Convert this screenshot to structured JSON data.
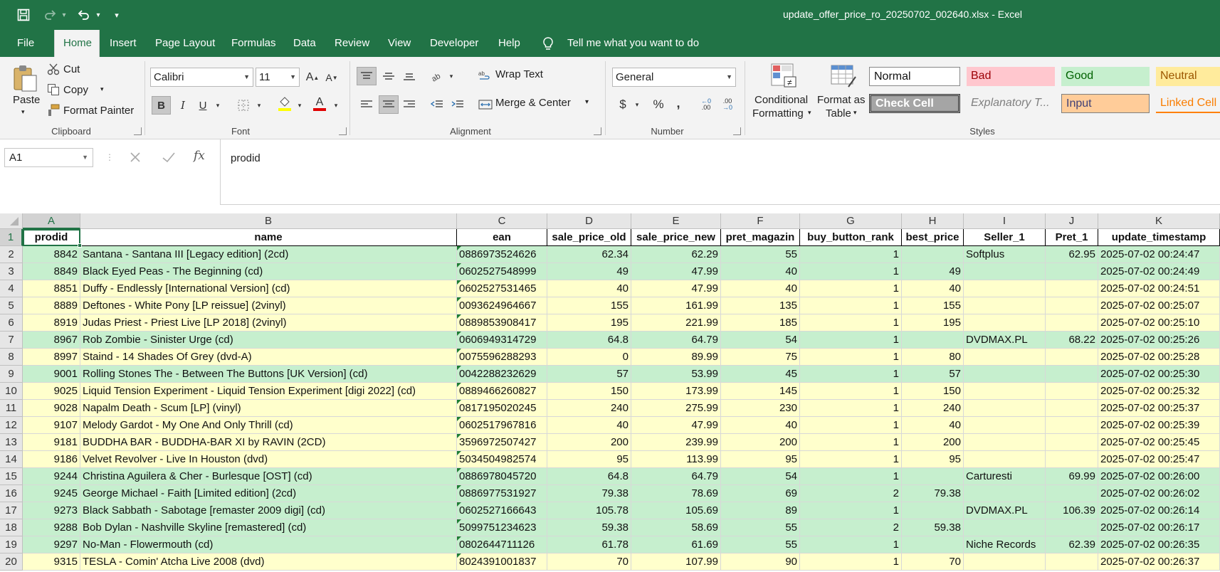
{
  "title_bar": {
    "document_title": "update_offer_price_ro_20250702_002640.xlsx  -  Excel",
    "save_icon": "save-icon",
    "redo_icon": "redo-icon",
    "undo_icon": "undo-icon",
    "customize_icon": "customize-qat-icon"
  },
  "tabs": [
    "File",
    "Home",
    "Insert",
    "Page Layout",
    "Formulas",
    "Data",
    "Review",
    "View",
    "Developer",
    "Help"
  ],
  "active_tab": "Home",
  "tell_me": "Tell me what you want to do",
  "ribbon": {
    "clipboard": {
      "paste": "Paste",
      "cut": "Cut",
      "copy": "Copy",
      "format_painter": "Format Painter",
      "label": "Clipboard"
    },
    "font": {
      "family": "Calibri",
      "size": "11",
      "bold": "B",
      "italic": "I",
      "underline": "U",
      "grow": "A",
      "shrink": "A",
      "font_color": "A",
      "label": "Font"
    },
    "alignment": {
      "wrap_text": "Wrap Text",
      "merge_center": "Merge & Center",
      "label": "Alignment"
    },
    "number": {
      "format": "General",
      "currency": "$",
      "percent": "%",
      "comma": ",",
      "inc_decimal": ".00",
      "dec_decimal": ".00",
      "label": "Number"
    },
    "styles": {
      "conditional": "Conditional",
      "conditional2": "Formatting",
      "format_table": "Format as",
      "format_table2": "Table",
      "cells": {
        "normal": "Normal",
        "bad": "Bad",
        "good": "Good",
        "neutral": "Neutral",
        "check_cell": "Check Cell",
        "explanatory": "Explanatory T...",
        "input": "Input",
        "linked_cell": "Linked Cell"
      },
      "label": "Styles"
    }
  },
  "formula_bar": {
    "name_box": "A1",
    "fx": "fx",
    "value": "prodid"
  },
  "sheet": {
    "columns": [
      "A",
      "B",
      "C",
      "D",
      "E",
      "F",
      "G",
      "H",
      "I",
      "J",
      "K"
    ],
    "headers": [
      "prodid",
      "name",
      "ean",
      "sale_price_old",
      "sale_price_new",
      "pret_magazin",
      "buy_button_rank",
      "best_price",
      "Seller_1",
      "Pret_1",
      "update_timestamp"
    ],
    "fill_colors": {
      "green": "#c6efce",
      "yellow": "#ffffcc"
    },
    "rows": [
      {
        "n": "2",
        "fill": "green",
        "cells": [
          "8842",
          "Santana - Santana  III [Legacy edition] (2cd)",
          "0886973524626",
          "62.34",
          "62.29",
          "55",
          "1",
          "",
          "Softplus",
          "62.95",
          "2025-07-02 00:24:47"
        ]
      },
      {
        "n": "3",
        "fill": "green",
        "cells": [
          "8849",
          "Black Eyed Peas - The Beginning (cd)",
          "0602527548999",
          "49",
          "47.99",
          "40",
          "1",
          "49",
          "",
          "",
          "2025-07-02 00:24:49"
        ]
      },
      {
        "n": "4",
        "fill": "yellow",
        "cells": [
          "8851",
          "Duffy - Endlessly [International Version] (cd)",
          "0602527531465",
          "40",
          "47.99",
          "40",
          "1",
          "40",
          "",
          "",
          "2025-07-02 00:24:51"
        ]
      },
      {
        "n": "5",
        "fill": "yellow",
        "cells": [
          "8889",
          "Deftones - White Pony [LP reissue] (2vinyl)",
          "0093624964667",
          "155",
          "161.99",
          "135",
          "1",
          "155",
          "",
          "",
          "2025-07-02 00:25:07"
        ]
      },
      {
        "n": "6",
        "fill": "yellow",
        "cells": [
          "8919",
          "Judas Priest - Priest Live [LP 2018] (2vinyl)",
          "0889853908417",
          "195",
          "221.99",
          "185",
          "1",
          "195",
          "",
          "",
          "2025-07-02 00:25:10"
        ]
      },
      {
        "n": "7",
        "fill": "green",
        "cells": [
          "8967",
          "Rob Zombie - Sinister Urge (cd)",
          "0606949314729",
          "64.8",
          "64.79",
          "54",
          "1",
          "",
          "DVDMAX.PL",
          "68.22",
          "2025-07-02 00:25:26"
        ]
      },
      {
        "n": "8",
        "fill": "yellow",
        "cells": [
          "8997",
          "Staind - 14 Shades Of Grey (dvd-A)",
          "0075596288293",
          "0",
          "89.99",
          "75",
          "1",
          "80",
          "",
          "",
          "2025-07-02 00:25:28"
        ]
      },
      {
        "n": "9",
        "fill": "green",
        "cells": [
          "9001",
          "Rolling Stones The - Between The Buttons [UK Version] (cd)",
          "0042288232629",
          "57",
          "53.99",
          "45",
          "1",
          "57",
          "",
          "",
          "2025-07-02 00:25:30"
        ]
      },
      {
        "n": "10",
        "fill": "yellow",
        "cells": [
          "9025",
          "Liquid Tension Experiment - Liquid Tension Experiment [digi 2022] (cd)",
          "0889466260827",
          "150",
          "173.99",
          "145",
          "1",
          "150",
          "",
          "",
          "2025-07-02 00:25:32"
        ]
      },
      {
        "n": "11",
        "fill": "yellow",
        "cells": [
          "9028",
          "Napalm Death - Scum [LP] (vinyl)",
          "0817195020245",
          "240",
          "275.99",
          "230",
          "1",
          "240",
          "",
          "",
          "2025-07-02 00:25:37"
        ]
      },
      {
        "n": "12",
        "fill": "yellow",
        "cells": [
          "9107",
          "Melody Gardot - My One And Only Thrill (cd)",
          "0602517967816",
          "40",
          "47.99",
          "40",
          "1",
          "40",
          "",
          "",
          "2025-07-02 00:25:39"
        ]
      },
      {
        "n": "13",
        "fill": "yellow",
        "cells": [
          "9181",
          "BUDDHA BAR - BUDDHA-BAR XI by RAVIN (2CD)",
          "3596972507427",
          "200",
          "239.99",
          "200",
          "1",
          "200",
          "",
          "",
          "2025-07-02 00:25:45"
        ]
      },
      {
        "n": "14",
        "fill": "yellow",
        "cells": [
          "9186",
          "Velvet Revolver - Live In Houston (dvd)",
          "5034504982574",
          "95",
          "113.99",
          "95",
          "1",
          "95",
          "",
          "",
          "2025-07-02 00:25:47"
        ]
      },
      {
        "n": "15",
        "fill": "green",
        "cells": [
          "9244",
          "Christina Aguilera & Cher - Burlesque [OST] (cd)",
          "0886978045720",
          "64.8",
          "64.79",
          "54",
          "1",
          "",
          "Carturesti",
          "69.99",
          "2025-07-02 00:26:00"
        ]
      },
      {
        "n": "16",
        "fill": "green",
        "cells": [
          "9245",
          "George Michael - Faith [Limited edition] (2cd)",
          "0886977531927",
          "79.38",
          "78.69",
          "69",
          "2",
          "79.38",
          "",
          "",
          "2025-07-02 00:26:02"
        ]
      },
      {
        "n": "17",
        "fill": "green",
        "cells": [
          "9273",
          "Black Sabbath - Sabotage [remaster 2009 digi] (cd)",
          "0602527166643",
          "105.78",
          "105.69",
          "89",
          "1",
          "",
          "DVDMAX.PL",
          "106.39",
          "2025-07-02 00:26:14"
        ]
      },
      {
        "n": "18",
        "fill": "green",
        "cells": [
          "9288",
          "Bob Dylan - Nashville Skyline [remastered] (cd)",
          "5099751234623",
          "59.38",
          "58.69",
          "55",
          "2",
          "59.38",
          "",
          "",
          "2025-07-02 00:26:17"
        ]
      },
      {
        "n": "19",
        "fill": "green",
        "cells": [
          "9297",
          "No-Man - Flowermouth (cd)",
          "0802644711126",
          "61.78",
          "61.69",
          "55",
          "1",
          "",
          "Niche Records",
          "62.39",
          "2025-07-02 00:26:35"
        ]
      },
      {
        "n": "20",
        "fill": "yellow",
        "cells": [
          "9315",
          "TESLA - Comin' Atcha Live 2008 (dvd)",
          "8024391001837",
          "70",
          "107.99",
          "90",
          "1",
          "70",
          "",
          "",
          "2025-07-02 00:26:37"
        ]
      }
    ]
  }
}
